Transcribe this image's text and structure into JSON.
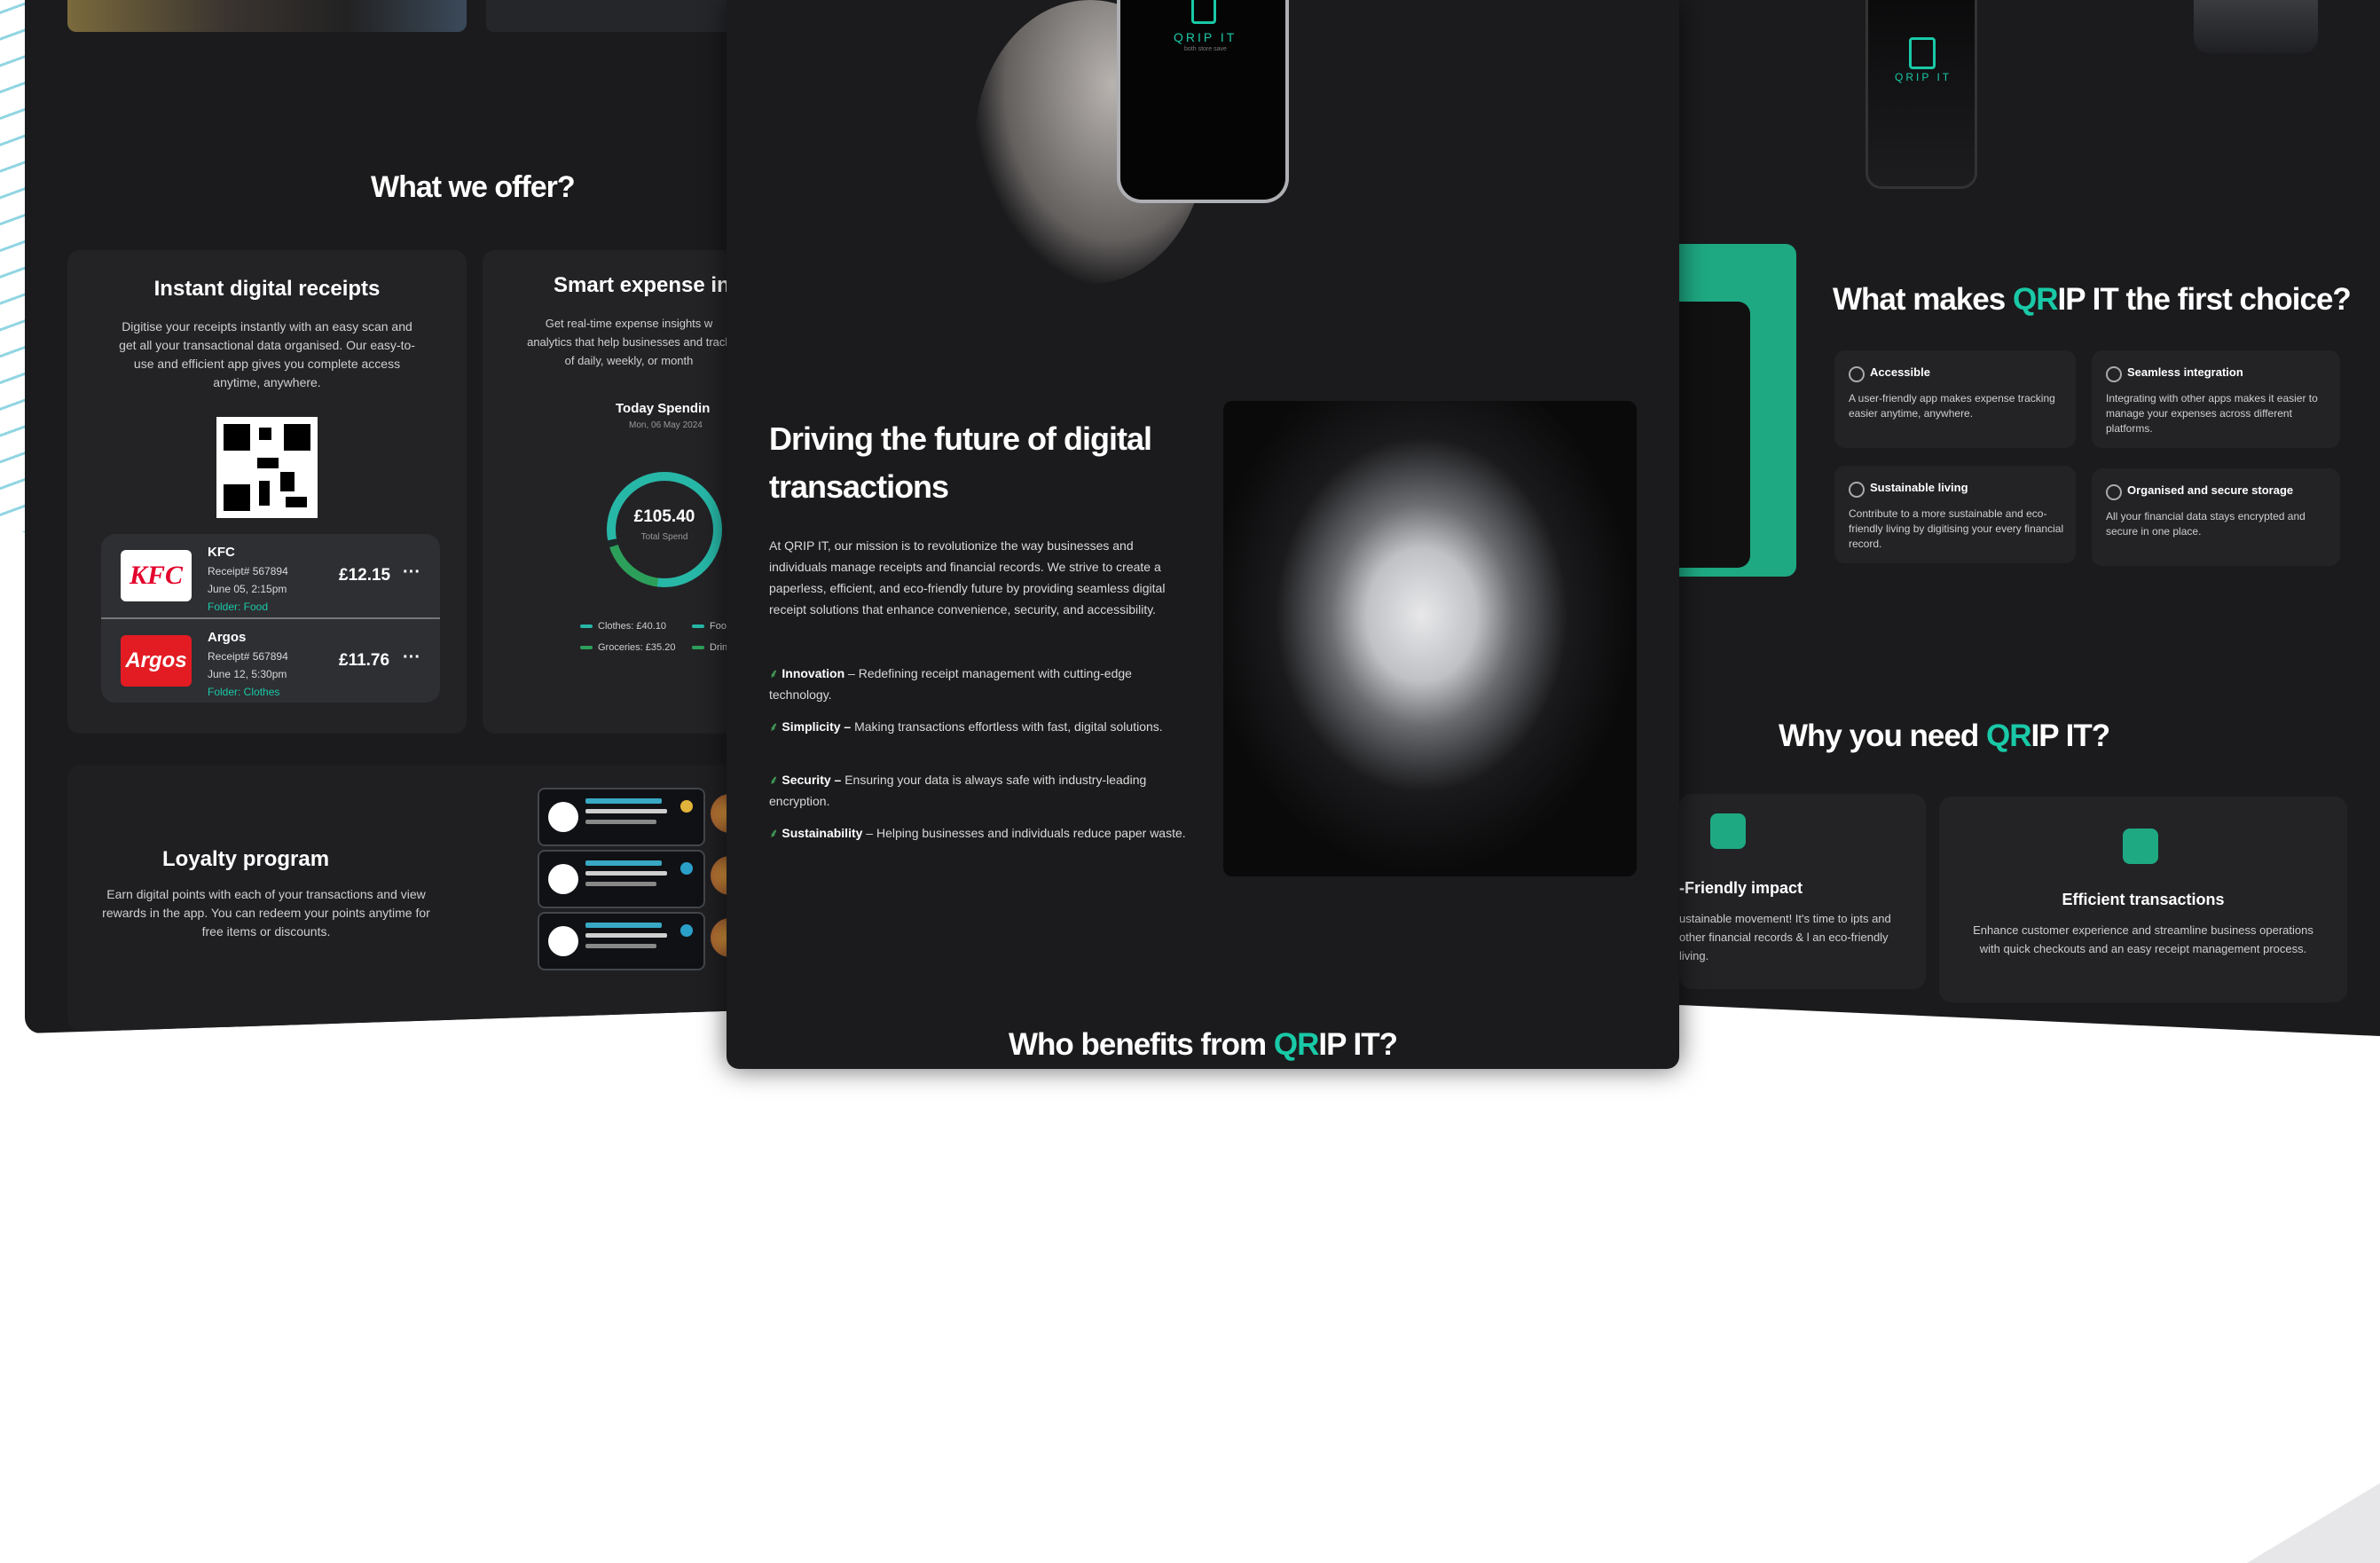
{
  "colors": {
    "accent": "#19c9a7",
    "panel": "#1b1b1d",
    "card": "#232326",
    "green": "#1ea983"
  },
  "left": {
    "offer_title": "What we offer?",
    "receipts_card": {
      "title": "Instant digital receipts",
      "desc": "Digitise your receipts instantly with an easy scan and get all your transactional data organised. Our easy-to-use and efficient app gives you complete access anytime, anywhere.",
      "items": [
        {
          "brand": "KFC",
          "name": "KFC",
          "receipt": "Receipt# 567894",
          "date": "June 05, 2:15pm",
          "folder": "Folder: Food",
          "amount": "£12.15",
          "more": "···"
        },
        {
          "brand": "Argos",
          "name": "Argos",
          "receipt": "Receipt# 567894",
          "date": "June 12, 5:30pm",
          "folder": "Folder: Clothes",
          "amount": "£11.76",
          "more": "···"
        }
      ]
    },
    "expense_card": {
      "title": "Smart expense in",
      "desc": "Get real-time expense insights w analytics that help businesses and track of daily, weekly, or month",
      "today": "Today Spendin",
      "date": "Mon, 06 May 2024",
      "total": "£105.40",
      "total_label": "Total Spend",
      "legend": [
        "Clothes: £40.10",
        "Food",
        "Groceries: £35.20",
        "Drin"
      ]
    },
    "loyalty": {
      "title": "Loyalty program",
      "desc": "Earn digital points with each of your transactions and view rewards in the app. You can redeem your points anytime for free items or discounts."
    }
  },
  "center": {
    "phone_text": "QRIP IT",
    "phone_sub": "both store save",
    "title": "Driving the future of digital transactions",
    "desc": "At QRIP IT, our mission is to revolutionize the way businesses and individuals manage receipts and financial records. We strive to create a paperless, efficient, and eco-friendly future by providing seamless digital receipt solutions that enhance convenience, security, and accessibility.",
    "bullets": [
      {
        "label": "Innovation",
        "sep": " – ",
        "text": "Redefining receipt management with cutting-edge technology."
      },
      {
        "label": "Simplicity –",
        "sep": " ",
        "text": "Making transactions effortless with fast, digital solutions."
      },
      {
        "label": "Security –",
        "sep": " ",
        "text": "Ensuring your data is always safe with industry-leading encryption."
      },
      {
        "label": "Sustainability",
        "sep": " – ",
        "text": "Helping businesses and individuals reduce paper waste."
      }
    ],
    "benefit_pre": "Who benefits from ",
    "benefit_accent": "QR",
    "benefit_post": "IP IT?"
  },
  "right": {
    "phone_text": "QRIP IT",
    "title_pre": "What makes ",
    "title_accent": "QR",
    "title_post": "IP IT the first choice?",
    "features": [
      {
        "title": "Accessible",
        "desc": "A user-friendly app makes expense tracking easier anytime, anywhere."
      },
      {
        "title": "Seamless integration",
        "desc": "Integrating with other apps makes it easier to manage your expenses across different platforms."
      },
      {
        "title": "Sustainable living",
        "desc": "Contribute to a more sustainable and eco-friendly living by digitising your every financial record."
      },
      {
        "title": "Organised and secure storage",
        "desc": "All your financial data stays encrypted and secure in one place."
      }
    ],
    "why_pre": "Why you need ",
    "why_accent": "QR",
    "why_post": "IP IT?",
    "why_cards": [
      {
        "title": "-Friendly impact",
        "desc": "ustainable movement! It's time to ipts and other financial records & l an eco-friendly living."
      },
      {
        "title": "Efficient transactions",
        "desc": "Enhance customer experience and streamline business operations with quick checkouts and an easy receipt management process."
      }
    ]
  }
}
